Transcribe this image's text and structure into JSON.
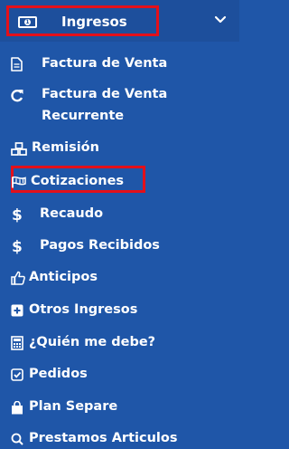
{
  "header": {
    "title": "Ingresos",
    "icon": "money-bill-icon",
    "chevron_icon": "chevron-down-icon"
  },
  "colors": {
    "background": "#1f56a8",
    "header_background": "#1d4f9c",
    "text": "#ffffff",
    "highlight_border": "#e3101a"
  },
  "menu": {
    "items": [
      {
        "label": "Factura de Venta",
        "icon": "file-text-icon"
      },
      {
        "label": "Factura de Venta Recurrente",
        "icon": "refresh-icon"
      },
      {
        "label": "Remisión",
        "icon": "cubes-icon"
      },
      {
        "label": "Cotizaciones",
        "icon": "flag-icon",
        "highlighted": true
      },
      {
        "label": "Recaudo",
        "icon": "dollar-icon"
      },
      {
        "label": "Pagos Recibidos",
        "icon": "dollar-icon"
      },
      {
        "label": "Anticipos",
        "icon": "thumbs-up-icon"
      },
      {
        "label": "Otros Ingresos",
        "icon": "plus-square-icon"
      },
      {
        "label": "¿Quién me debe?",
        "icon": "calculator-icon"
      },
      {
        "label": "Pedidos",
        "icon": "check-square-icon"
      },
      {
        "label": "Plan Separe",
        "icon": "shopping-bag-icon"
      },
      {
        "label": "Prestamos Articulos",
        "icon": "search-icon"
      }
    ]
  }
}
